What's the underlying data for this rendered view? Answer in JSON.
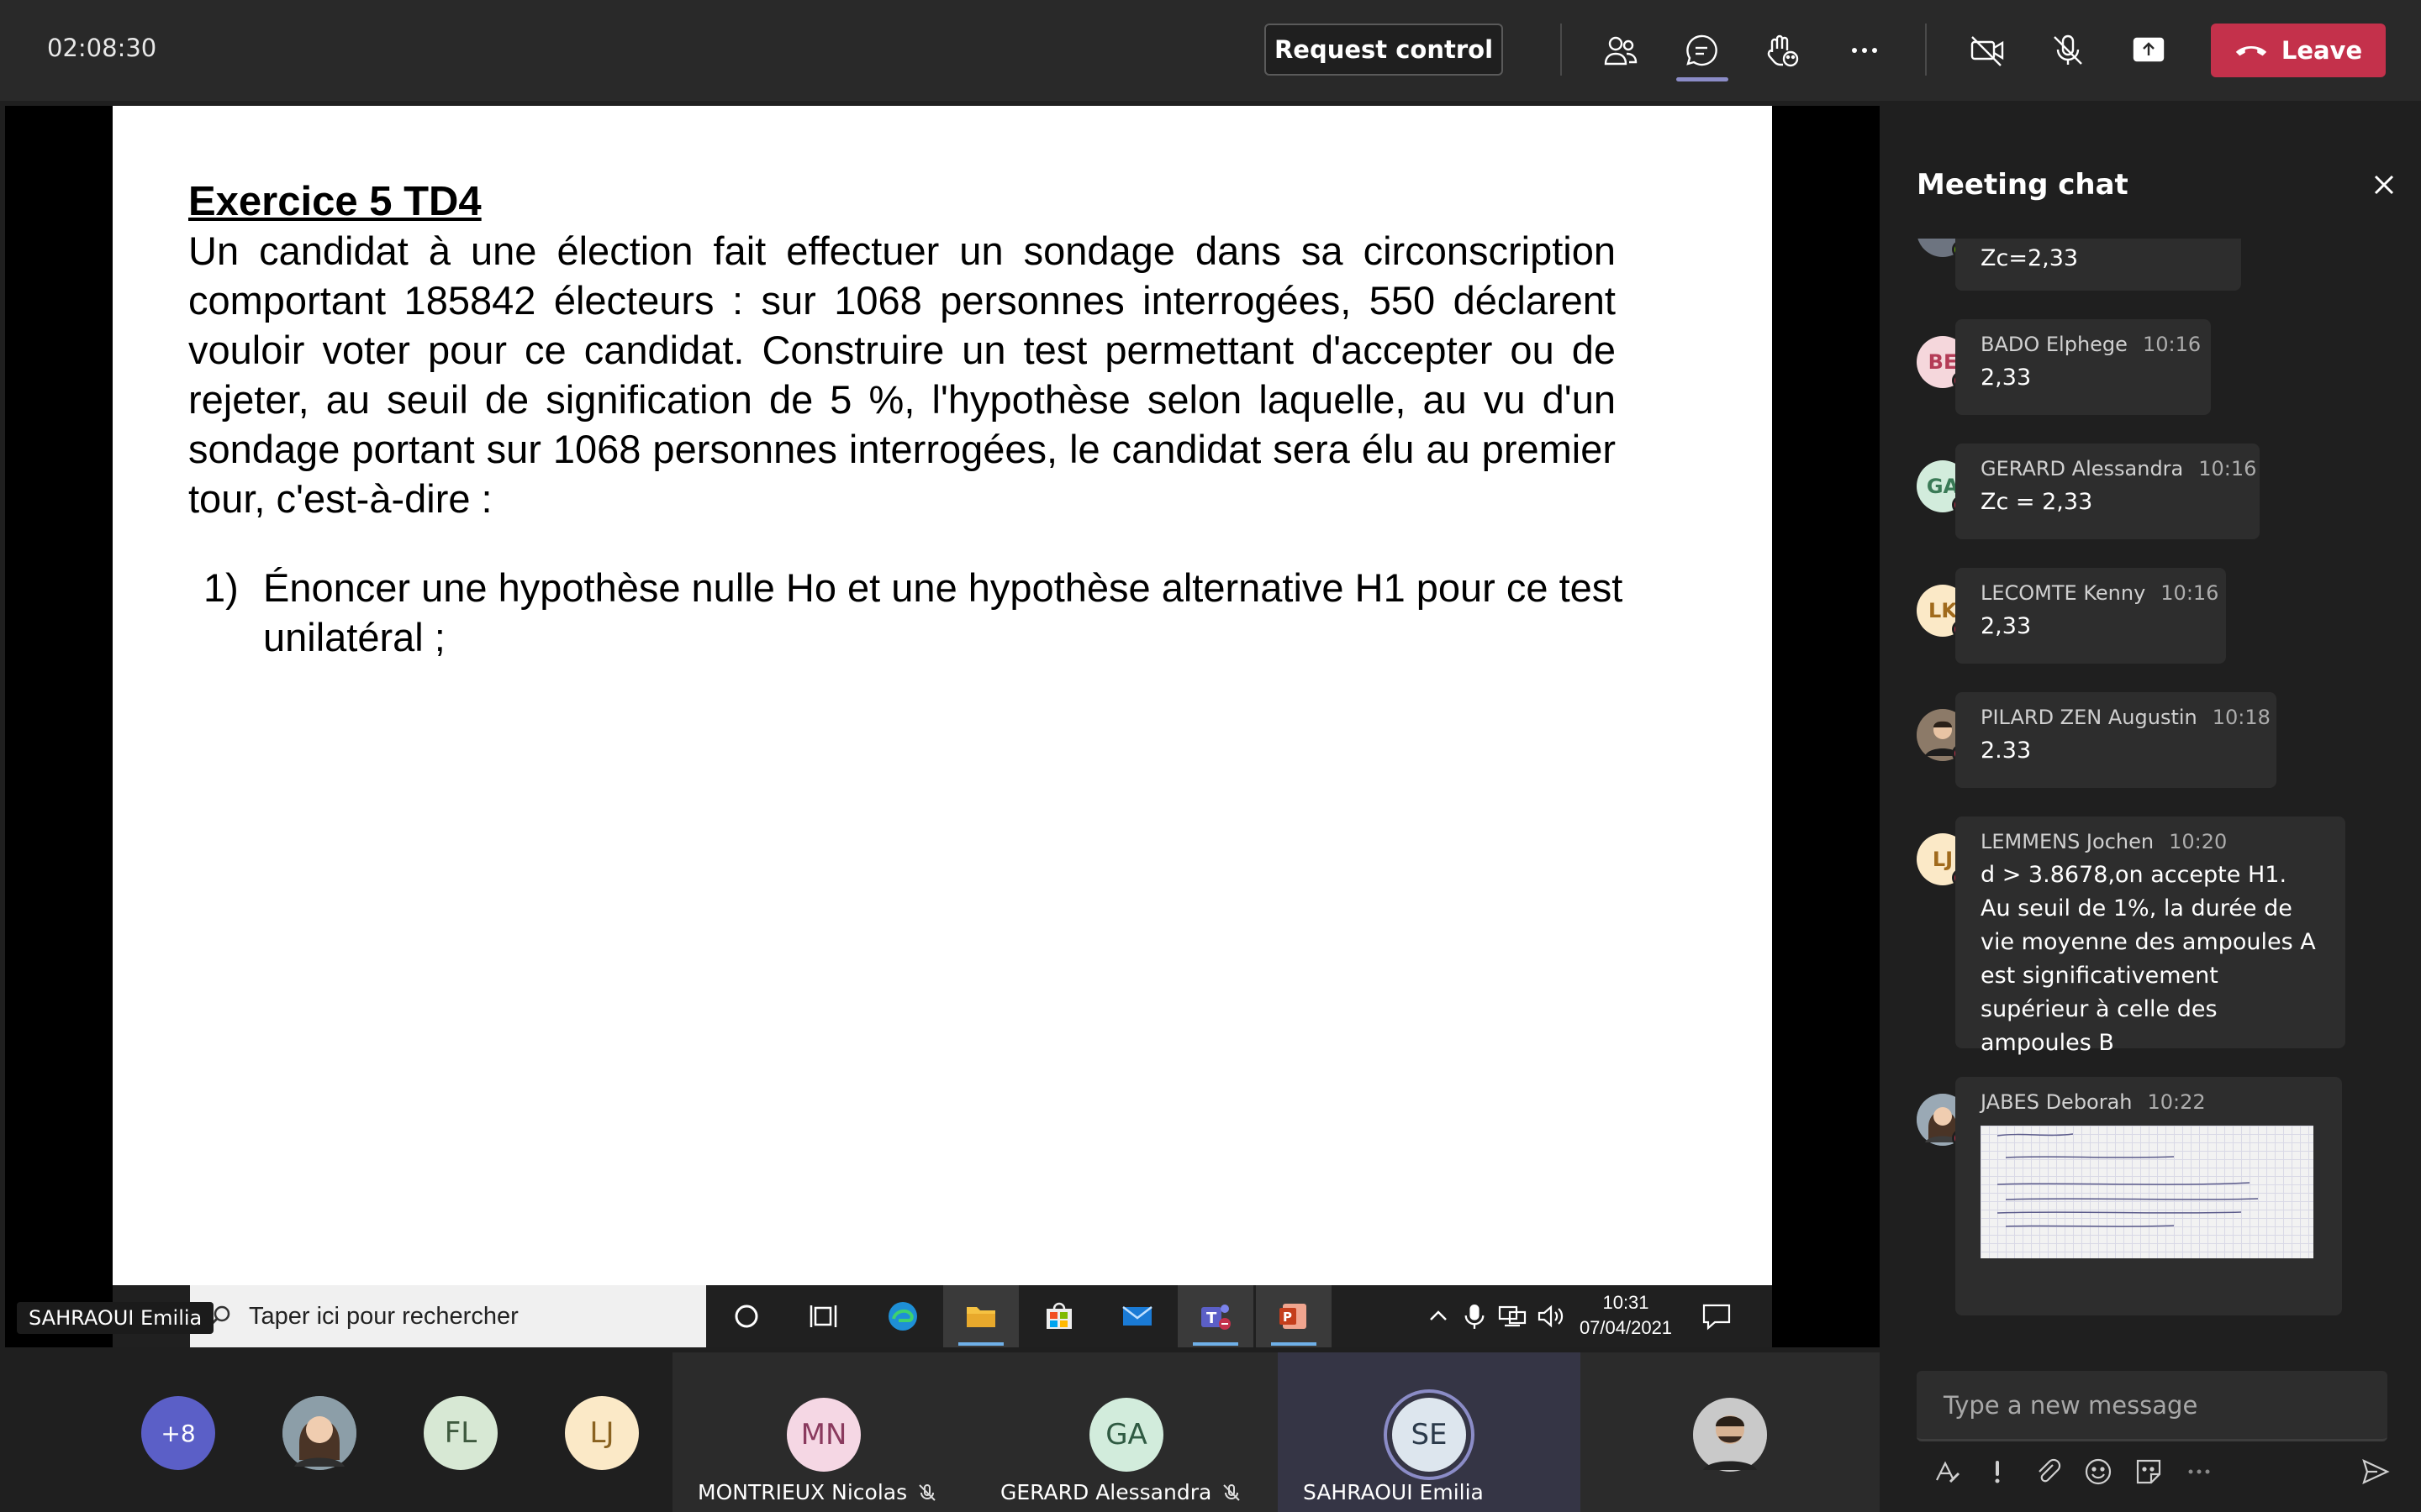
{
  "topbar": {
    "timer": "02:08:30",
    "request_control": "Request control",
    "leave": "Leave",
    "icons": [
      "participants-icon",
      "chat-icon",
      "reactions-icon",
      "more-icon",
      "camera-off-icon",
      "mic-off-icon",
      "share-icon"
    ]
  },
  "slide": {
    "title": "Exercice  5 TD4",
    "body": "Un candidat à une élection fait effectuer un sondage dans sa circonscription comportant 185842 électeurs : sur 1068 personnes interrogées, 550 déclarent vouloir voter pour ce candidat. Construire un test permettant d'accepter ou de rejeter, au seuil de signification de 5 %, l'hypothèse selon laquelle, au vu d'un sondage portant sur 1068 personnes interrogées, le candidat sera élu au premier tour, c'est-à-dire :",
    "q1_num": "1)",
    "q1_text": "Énoncer une hypothèse nulle Ho et une hypothèse alternative H1 pour ce test unilatéral ;"
  },
  "taskbar": {
    "search_placeholder": "Taper ici pour rechercher",
    "time": "10:31",
    "date": "07/04/2021"
  },
  "presenter_name": "SAHRAOUI Emilia",
  "chat": {
    "title": "Meeting chat",
    "messages": [
      {
        "initials": "",
        "name": "",
        "time": "",
        "text": "Zc=2,33"
      },
      {
        "initials": "BE",
        "name": "BADO Elphege",
        "time": "10:16",
        "text": "2,33"
      },
      {
        "initials": "GA",
        "name": "GERARD Alessandra",
        "time": "10:16",
        "text": "Zc = 2,33"
      },
      {
        "initials": "LK",
        "name": "LECOMTE Kenny",
        "time": "10:16",
        "text": "2,33"
      },
      {
        "initials": "",
        "name": "PILARD ZEN Augustin",
        "time": "10:18",
        "text": "2.33"
      },
      {
        "initials": "LJ",
        "name": "LEMMENS Jochen",
        "time": "10:20",
        "text": "d > 3.8678,on accepte H1. Au seuil de 1%, la durée de vie moyenne des ampoules A est significativement supérieur à celle des ampoules B"
      },
      {
        "initials": "",
        "name": "JABES Deborah",
        "time": "10:22",
        "text": ""
      }
    ],
    "input_placeholder": "Type a new message"
  },
  "participants": {
    "more": "+8",
    "circles": [
      "FL",
      "LJ"
    ],
    "tiles": [
      {
        "initials": "MN",
        "name": "MONTRIEUX Nicolas"
      },
      {
        "initials": "GA",
        "name": "GERARD Alessandra"
      },
      {
        "initials": "SE",
        "name": "SAHRAOUI Emilia"
      }
    ]
  },
  "colors": {
    "leave": "#c4314b",
    "accent": "#8b8cc7",
    "bg": "#1f1f1f"
  }
}
